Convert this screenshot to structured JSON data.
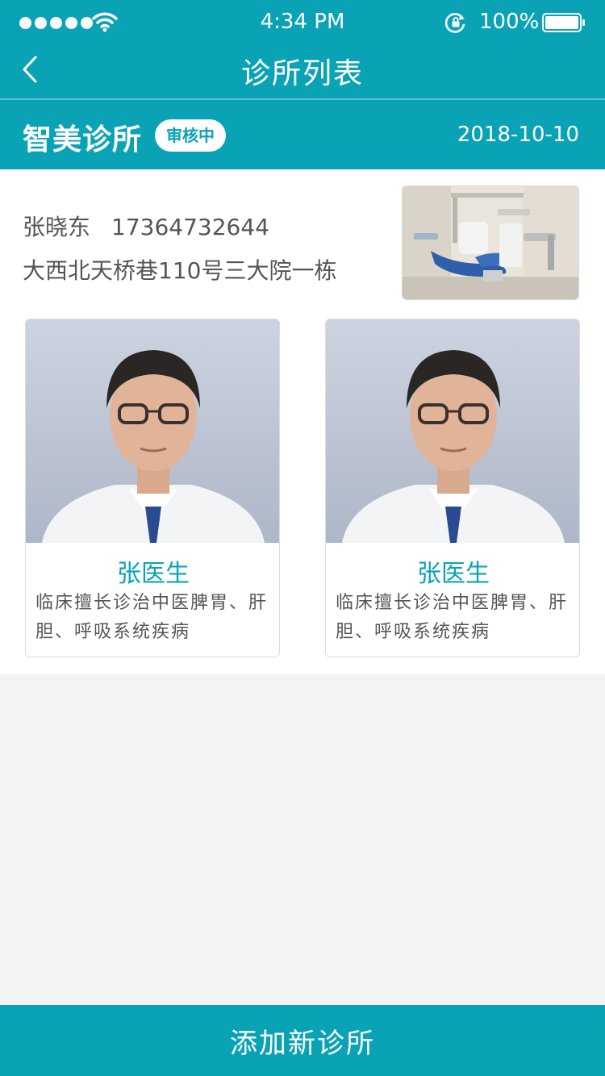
{
  "status_bar": {
    "time": "4:34 PM",
    "battery_percent": "100%",
    "icons": [
      "signal-dots-icon",
      "wifi-icon",
      "orientation-lock-icon",
      "battery-icon"
    ]
  },
  "nav": {
    "title": "诊所列表",
    "back_icon": "chevron-left-icon"
  },
  "clinic": {
    "name": "智美诊所",
    "status": "审核中",
    "date": "2018-10-10",
    "contact_name": "张晓东",
    "phone": "17364732644",
    "address": "大西北天桥巷110号三大院一栋"
  },
  "doctors": [
    {
      "name": "张医生",
      "description": "临床擅长诊治中医脾胃、肝胆、呼吸系统疾病"
    },
    {
      "name": "张医生",
      "description": "临床擅长诊治中医脾胃、肝胆、呼吸系统疾病"
    }
  ],
  "footer": {
    "add_button_label": "添加新诊所"
  },
  "colors": {
    "primary": "#0aa3b6",
    "background": "#f3f3f3",
    "text": "#555555"
  }
}
